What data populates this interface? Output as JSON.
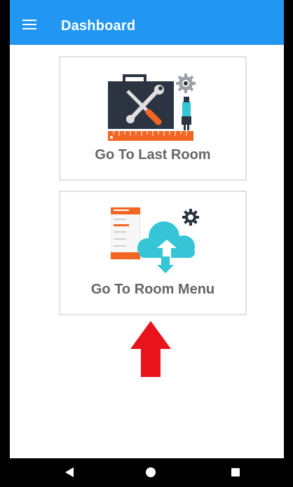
{
  "appbar": {
    "title": "Dashboard",
    "menu_icon": "hamburger-menu-icon",
    "color": "#2196f3"
  },
  "cards": [
    {
      "label": "Go To Last Room",
      "icon": "toolbox-icon"
    },
    {
      "label": "Go To Room Menu",
      "icon": "cloud-upload-icon"
    }
  ],
  "annotation": {
    "icon": "red-up-arrow-icon",
    "color": "#e8141c"
  },
  "navbar": {
    "back_icon": "back-triangle-icon",
    "home_icon": "home-circle-icon",
    "recents_icon": "recents-square-icon"
  }
}
